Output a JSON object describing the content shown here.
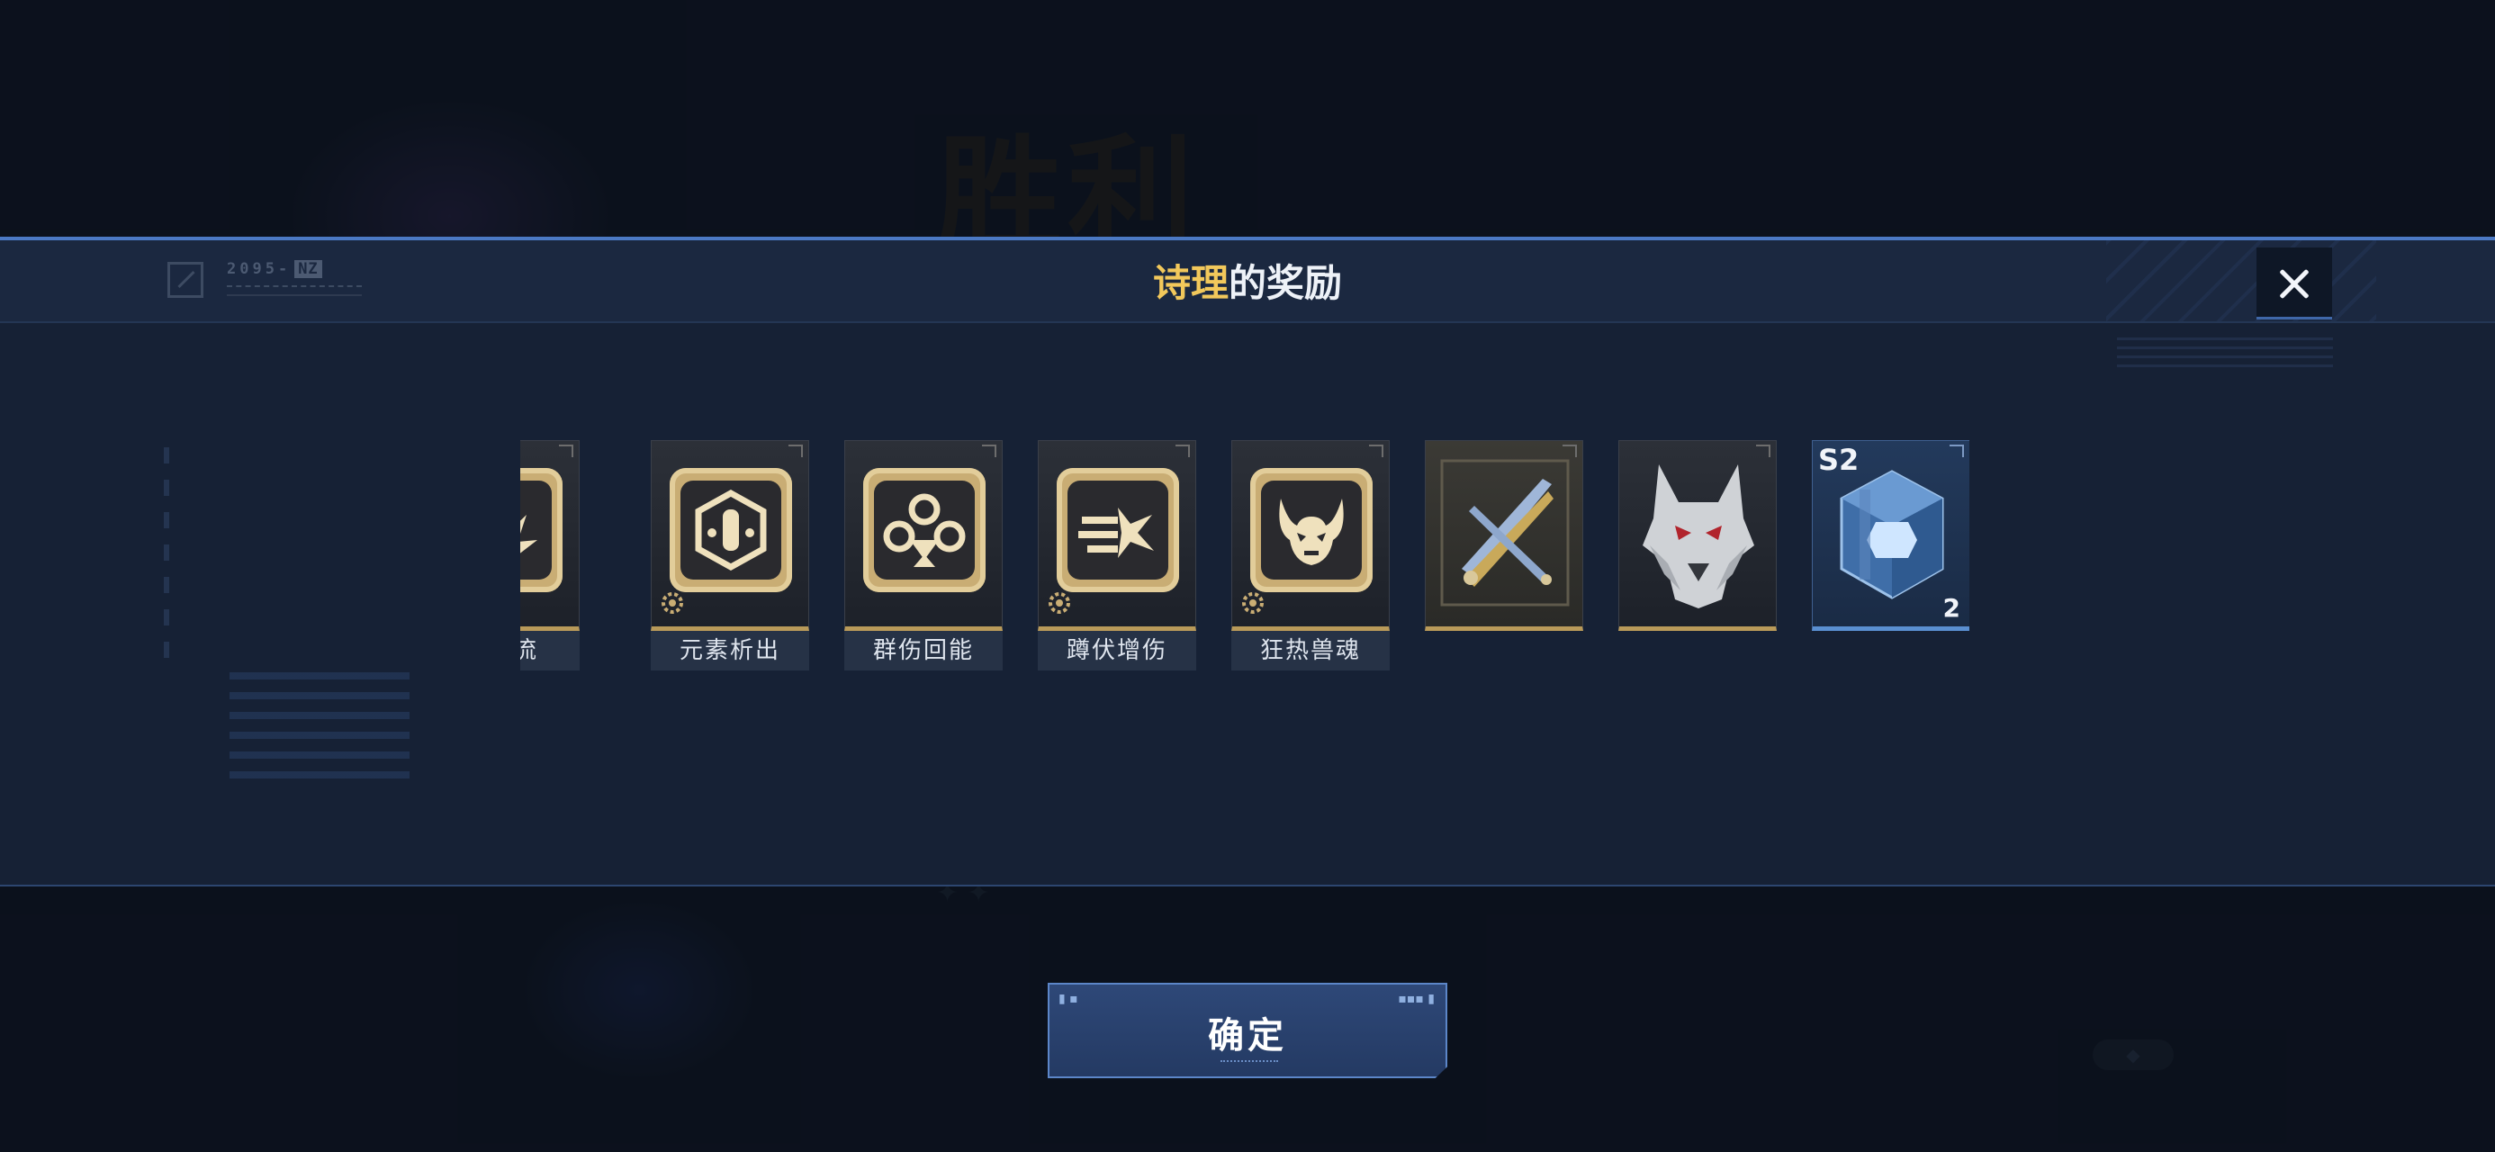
{
  "background": {
    "title": "胜利"
  },
  "dialog": {
    "title_name": "诗理",
    "title_rest": "的奖励",
    "header_code": "2095-",
    "header_tag": "NZ"
  },
  "rewards": [
    {
      "label": "击涌流",
      "type": "skill",
      "icon": "burst-emblem-icon"
    },
    {
      "label": "元素析出",
      "type": "skill",
      "icon": "element-hex-icon"
    },
    {
      "label": "群伤回能",
      "type": "skill",
      "icon": "triple-orb-icon"
    },
    {
      "label": "蹲伏增伤",
      "type": "skill",
      "icon": "dash-strike-icon"
    },
    {
      "label": "狂热兽魂",
      "type": "skill",
      "icon": "beast-skull-icon"
    },
    {
      "label": "",
      "type": "weapon",
      "icon": "twin-blades-icon"
    },
    {
      "label": "",
      "type": "cosmetic",
      "icon": "wolf-head-icon"
    },
    {
      "label": "",
      "type": "material",
      "icon": "crystal-cube-icon",
      "tag": "S2",
      "quantity": "2"
    }
  ],
  "confirm": {
    "label": "确定"
  },
  "colors": {
    "accent_gold": "#f2c85b",
    "accent_blue": "#4b79c4",
    "card_gold_edge": "#b99a59"
  }
}
